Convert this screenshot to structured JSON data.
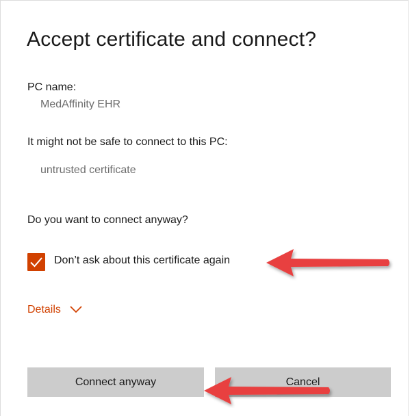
{
  "dialog": {
    "title": "Accept certificate and connect?",
    "pc_name_label": "PC name:",
    "pc_name_value": "MedAffinity EHR",
    "warning_label": "It might not be safe to connect to this PC:",
    "warning_value": "untrusted certificate",
    "question": "Do you want to connect anyway?",
    "checkbox_label": "Don’t ask about this certificate again",
    "checkbox_checked": true,
    "details_label": "Details",
    "connect_label": "Connect anyway",
    "cancel_label": "Cancel"
  },
  "colors": {
    "accent": "#d14100",
    "button_bg": "#cccccc",
    "annotation_arrow": "#e8403f"
  },
  "icons": {
    "checkbox": "checkmark-icon",
    "details": "chevron-down-icon",
    "annotations": "red-arrow-icon"
  }
}
